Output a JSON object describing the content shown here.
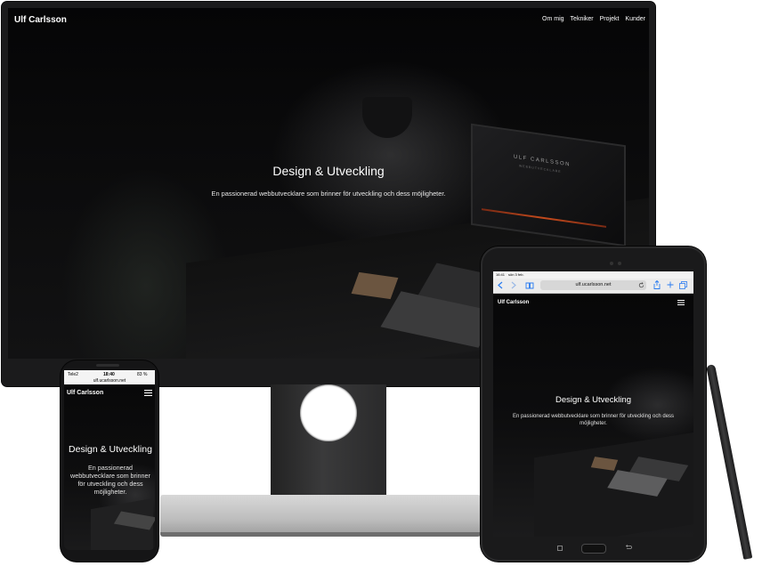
{
  "desktop": {
    "brand": "Ulf Carlsson",
    "nav": [
      {
        "label": "Om mig"
      },
      {
        "label": "Tekniker"
      },
      {
        "label": "Projekt"
      },
      {
        "label": "Kunder"
      }
    ],
    "hero": {
      "title": "Design & Utveckling",
      "subtitle": "En passionerad webbutvecklare som brinner för utveckling och dess möjligheter."
    },
    "screen_brand": "ULF CARLSSON",
    "screen_tagline": "WEBBUTVECKLARE"
  },
  "phone": {
    "status": {
      "carrier": "Tele2",
      "time": "18:40",
      "battery": "83 %"
    },
    "url": "ulf.ucarlsson.net",
    "brand": "Ulf Carlsson",
    "hero": {
      "title": "Design & Utveckling",
      "subtitle": "En passionerad webbutvecklare som brinner för utveckling och dess möjligheter."
    }
  },
  "tablet": {
    "status": {
      "time": "16:41",
      "date": "sön 3 feb."
    },
    "url": "ulf.ucarlsson.net",
    "brand": "Ulf Carlsson",
    "hero": {
      "title": "Design & Utveckling",
      "subtitle": "En passionerad webbutvecklare som brinner för utveckling och dess möjligheter."
    }
  },
  "colors": {
    "site_background": "#0b0b0c",
    "text": "#ffffff",
    "stand_silver": "#bdbdbd"
  }
}
